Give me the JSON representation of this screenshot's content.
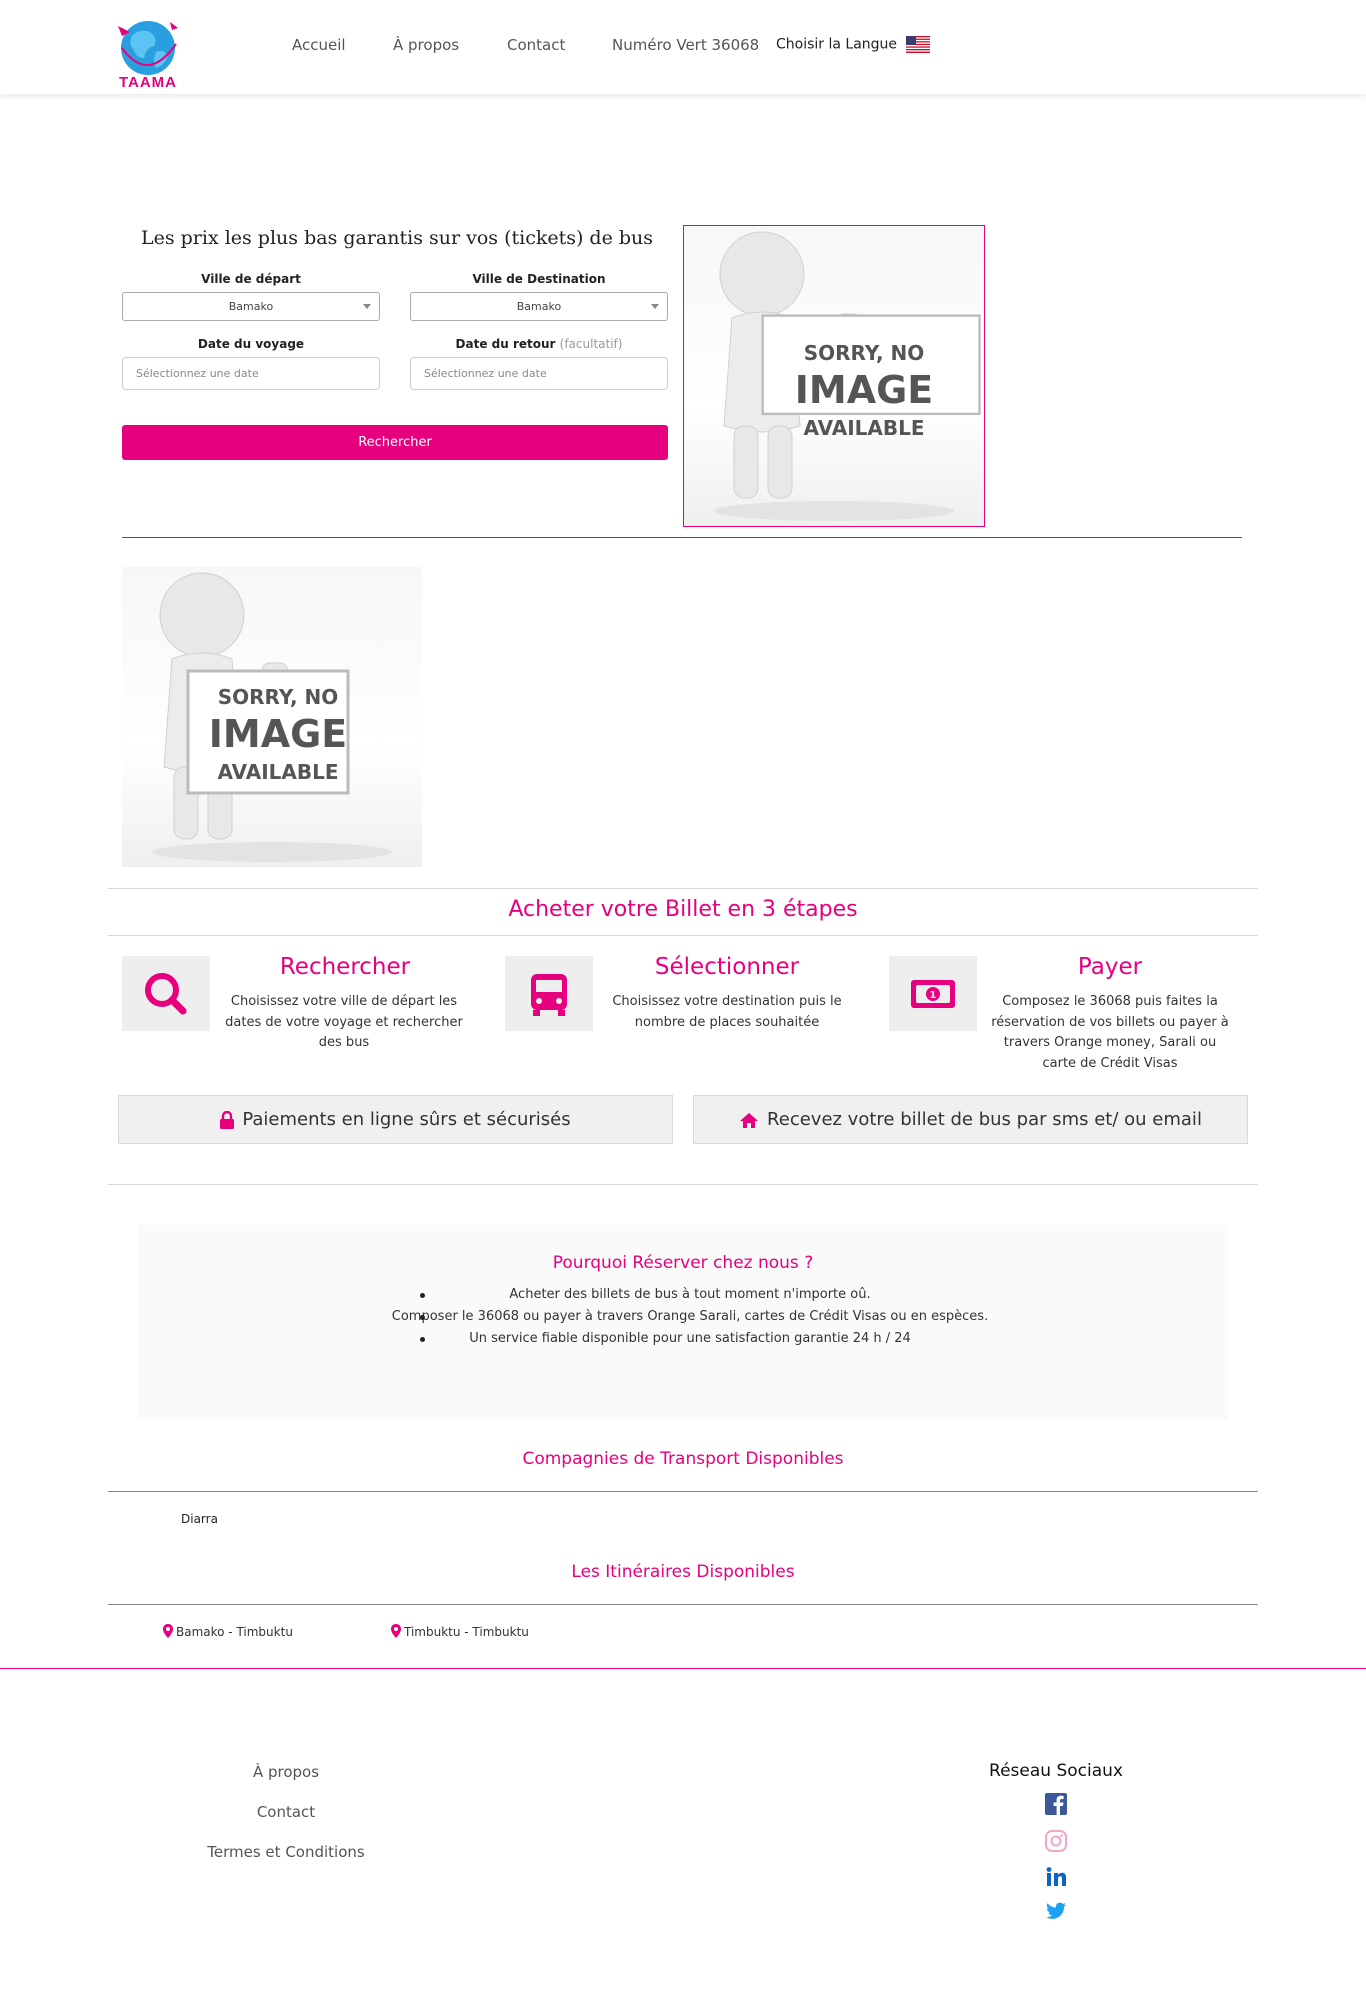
{
  "header": {
    "logo_text": "TAAMA",
    "nav": [
      {
        "label": "Accueil"
      },
      {
        "label": "À propos"
      },
      {
        "label": "Contact"
      },
      {
        "label": "Numéro Vert 36068"
      },
      {
        "label": "Choisir la Langue"
      }
    ]
  },
  "search": {
    "title": "Les prix les plus bas garantis sur vos (tickets) de bus",
    "departure_label": "Ville de départ",
    "departure_value": "Bamako",
    "destination_label": "Ville de Destination",
    "destination_value": "Bamako",
    "travel_date_label": "Date du voyage",
    "travel_date_placeholder": "Sélectionnez une date",
    "return_date_label": "Date du retour",
    "return_date_optional": "(facultatif)",
    "return_date_placeholder": "Sélectionnez une date",
    "button_label": "Rechercher"
  },
  "placeholder_image": {
    "line1": "SORRY, NO",
    "line2": "IMAGE",
    "line3": "AVAILABLE"
  },
  "steps": {
    "title": "Acheter votre Billet en 3 étapes",
    "items": [
      {
        "title": "Rechercher",
        "text": "Choisissez votre ville de départ les dates de votre voyage et rechercher des bus",
        "icon": "search-icon"
      },
      {
        "title": "Sélectionner",
        "text": "Choisissez votre destination puis le nombre de places souhaitée",
        "icon": "bus-icon"
      },
      {
        "title": "Payer",
        "text": "Composez le 36068 puis faites la réservation de vos billets ou payer à travers Orange money, Sarali ou carte de Crédit Visas",
        "icon": "money-icon"
      }
    ]
  },
  "features": [
    {
      "label": "Paiements en ligne sûrs et sécurisés",
      "icon": "lock-icon"
    },
    {
      "label": "Recevez votre billet de bus par sms et/ ou email",
      "icon": "home-icon"
    }
  ],
  "why": {
    "title": "Pourquoi Réserver chez nous ?",
    "items": [
      "Acheter des billets de bus à tout moment n'importe oû.",
      "Composer le 36068 ou payer à travers Orange Sarali, cartes de Crédit Visas ou en espèces.",
      "Un service fiable disponible pour une satisfaction garantie 24 h / 24"
    ]
  },
  "companies": {
    "title": "Compagnies de Transport Disponibles",
    "items": [
      "Diarra"
    ]
  },
  "routes": {
    "title": "Les Itinéraires Disponibles",
    "items": [
      "Bamako - Timbuktu",
      "Timbuktu - Timbuktu"
    ]
  },
  "footer": {
    "links": [
      "À propos",
      "Contact",
      "Termes et Conditions"
    ],
    "social_title": "Réseau Sociaux",
    "social": [
      "facebook-icon",
      "instagram-icon",
      "linkedin-icon",
      "twitter-icon"
    ]
  },
  "colors": {
    "accent": "#e6007e",
    "panel": "#fafafa",
    "facebook": "#3b5998",
    "instagram": "#f3a6c8",
    "linkedin": "#0a66c2",
    "twitter": "#1da1f2"
  }
}
